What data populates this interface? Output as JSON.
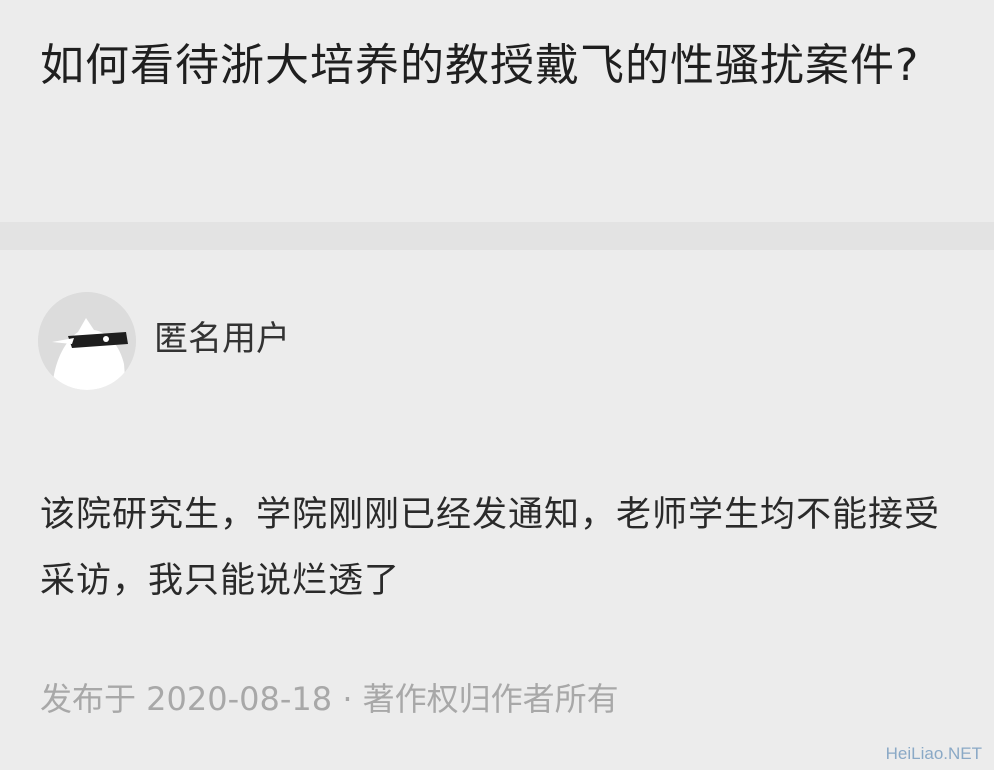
{
  "question": {
    "title": "如何看待浙大培养的教授戴飞的性骚扰案件?"
  },
  "answer": {
    "author": {
      "name": "匿名用户",
      "avatar_icon": "anonymous-avatar-icon"
    },
    "content": "该院研究生，学院刚刚已经发通知，老师学生均不能接受采访，我只能说烂透了",
    "meta": "发布于 2020-08-18 · 著作权归作者所有"
  },
  "watermark": "HeiLiao.NET",
  "colors": {
    "background": "#ececec",
    "divider": "#e3e3e3",
    "title_text": "#1f1f1f",
    "meta_text": "#a8a8a8",
    "watermark_text": "#8aa9c6"
  }
}
